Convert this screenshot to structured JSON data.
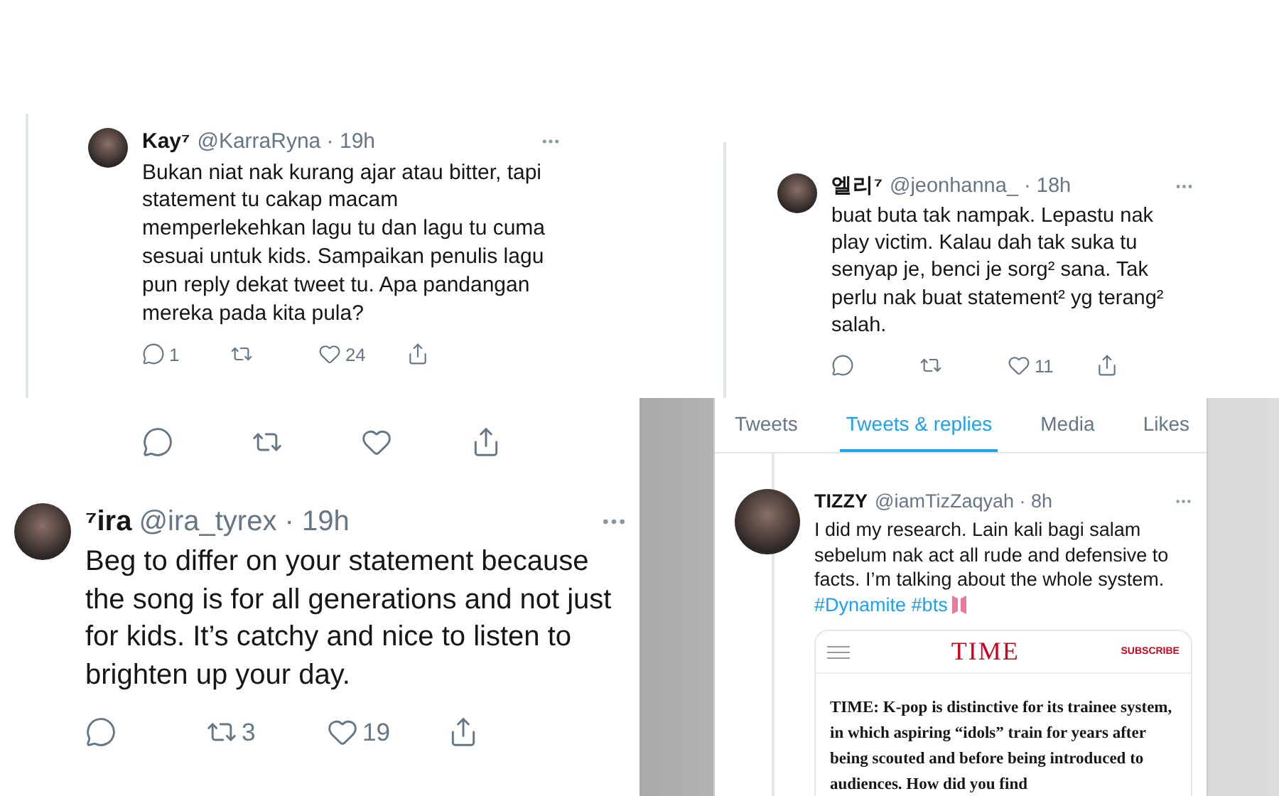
{
  "kay_tweet": {
    "name": "Kay⁷",
    "handle": "@KarraRyna · 19h",
    "text": "Bukan niat nak kurang ajar atau bitter, tapi statement tu cakap macam memperlekehkan lagu tu dan lagu tu cuma sesuai untuk kids. Sampaikan penulis lagu pun reply dekat tweet tu. Apa pandangan mereka pada kita pula?",
    "actions": [
      {
        "kind": "reply",
        "count": "1"
      },
      {
        "kind": "retweet"
      },
      {
        "kind": "like",
        "count": "24"
      },
      {
        "kind": "share"
      }
    ]
  },
  "elli_tweet": {
    "name": "엘리⁷",
    "handle": "@jeonhanna_ · 18h",
    "text": "buat buta tak nampak. Lepastu nak play victim. Kalau dah tak suka tu senyap je, benci je sorg² sana. Tak perlu nak buat statement² yg terang² salah.",
    "actions": [
      {
        "kind": "reply"
      },
      {
        "kind": "retweet"
      },
      {
        "kind": "like",
        "count": "11"
      },
      {
        "kind": "share"
      }
    ]
  },
  "ira_panel": {
    "previous_actions": [
      {
        "kind": "reply"
      },
      {
        "kind": "retweet"
      },
      {
        "kind": "like"
      },
      {
        "kind": "share"
      }
    ],
    "tweet": {
      "name": "⁷ira",
      "handle": "@ira_tyrex · 19h",
      "text": "Beg to differ on your statement because the song is for all generations and not just for kids. It’s catchy and nice to listen to brighten up your day.",
      "actions": [
        {
          "kind": "reply"
        },
        {
          "kind": "retweet",
          "count": "3"
        },
        {
          "kind": "like",
          "count": "19"
        },
        {
          "kind": "share"
        }
      ]
    }
  },
  "profile_panel": {
    "tabs": [
      {
        "label": "Tweets",
        "selected": false
      },
      {
        "label": "Tweets & replies",
        "selected": true
      },
      {
        "label": "Media",
        "selected": false
      },
      {
        "label": "Likes",
        "selected": false
      }
    ],
    "tweet": {
      "name": "TIZZY",
      "handle": "@iamTizZaqyah · 8h",
      "text": "I did my research. Lain kali bagi salam sebelum nak act all rude and defensive to facts. I’m talking about the whole system.",
      "hashtags": [
        "#Dynamite",
        "#bts"
      ],
      "card": {
        "logo": "TIME",
        "subscribe": "SUBSCRIBE",
        "text": "TIME: K-pop is distinctive for its trainee system, in which aspiring “idols” train for years after being scouted and before being introduced to audiences. How did you find"
      }
    }
  }
}
